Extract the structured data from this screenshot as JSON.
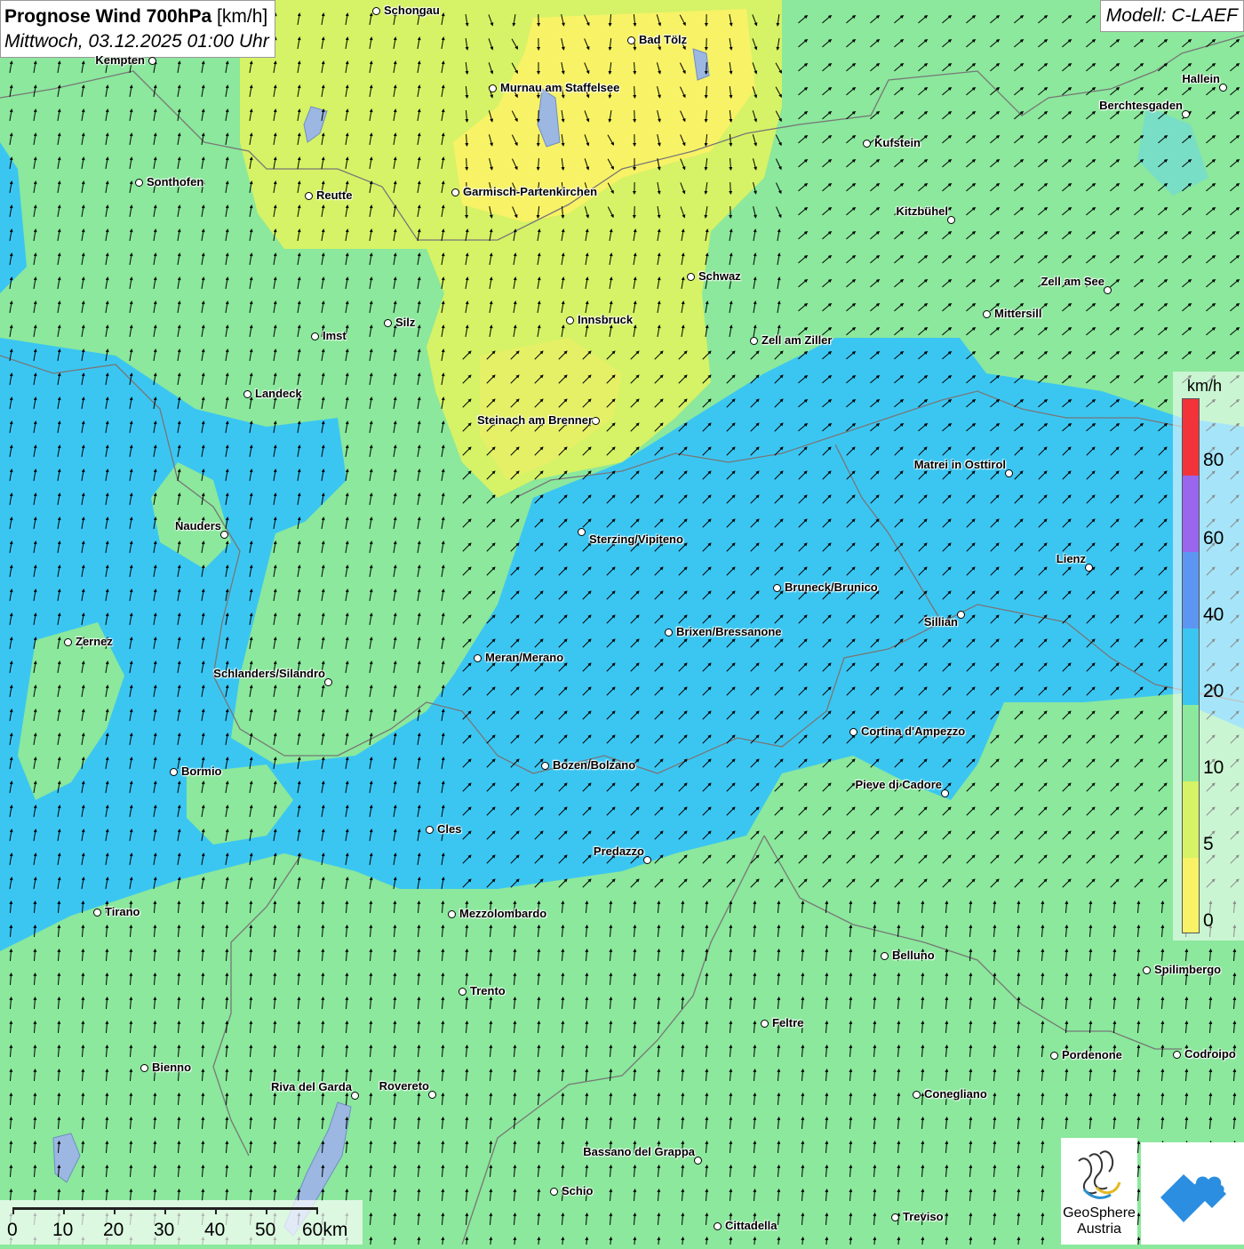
{
  "title": {
    "main": "Prognose Wind 700hPa",
    "unit": "[km/h]",
    "datetime": "Mittwoch, 03.12.2025 01:00 Uhr"
  },
  "model": "Modell: C-LAEF",
  "legend": {
    "unit": "km/h",
    "labels": [
      "80",
      "60",
      "40",
      "20",
      "10",
      "5",
      "0"
    ],
    "colors": [
      "#f2343a",
      "#9a66ee",
      "#5c96f2",
      "#3bc6f2",
      "#8be89c",
      "#d6f266",
      "#f8f266"
    ]
  },
  "scale": {
    "labels": [
      "0",
      "10",
      "20",
      "30",
      "40",
      "50",
      "60km"
    ]
  },
  "cities": [
    {
      "name": "Schongau"
    },
    {
      "name": "Bad Tölz"
    },
    {
      "name": "Kempten"
    },
    {
      "name": "Murnau am Staffelsee"
    },
    {
      "name": "Hallein"
    },
    {
      "name": "Berchtesgaden"
    },
    {
      "name": "Kufstein"
    },
    {
      "name": "Sonthofen"
    },
    {
      "name": "Reutte"
    },
    {
      "name": "Garmisch-Partenkirchen"
    },
    {
      "name": "Kitzbühel"
    },
    {
      "name": "Schwaz"
    },
    {
      "name": "Zell am See"
    },
    {
      "name": "Mittersill"
    },
    {
      "name": "Imst"
    },
    {
      "name": "Silz"
    },
    {
      "name": "Innsbruck"
    },
    {
      "name": "Zell am Ziller"
    },
    {
      "name": "Landeck"
    },
    {
      "name": "Steinach am Brenner"
    },
    {
      "name": "Matrei in Osttirol"
    },
    {
      "name": "Nauders"
    },
    {
      "name": "Sterzing/Vipiteno"
    },
    {
      "name": "Lienz"
    },
    {
      "name": "Bruneck/Brunico"
    },
    {
      "name": "Sillian"
    },
    {
      "name": "Zernez"
    },
    {
      "name": "Brixen/Bressanone"
    },
    {
      "name": "Meran/Merano"
    },
    {
      "name": "Schlanders/Silandro"
    },
    {
      "name": "Cortina d'Ampezzo"
    },
    {
      "name": "Bormio"
    },
    {
      "name": "Bozen/Bolzano"
    },
    {
      "name": "Pieve di Cadore"
    },
    {
      "name": "Cles"
    },
    {
      "name": "Predazzo"
    },
    {
      "name": "Tirano"
    },
    {
      "name": "Mezzolombardo"
    },
    {
      "name": "Belluno"
    },
    {
      "name": "Spilimbergo"
    },
    {
      "name": "Trento"
    },
    {
      "name": "Feltre"
    },
    {
      "name": "Pordenone"
    },
    {
      "name": "Codroipo"
    },
    {
      "name": "Bienno"
    },
    {
      "name": "Riva del Garda"
    },
    {
      "name": "Rovereto"
    },
    {
      "name": "Conegliano"
    },
    {
      "name": "Bassano del Grappa"
    },
    {
      "name": "Schio"
    },
    {
      "name": "Treviso"
    },
    {
      "name": "Cittadella"
    }
  ],
  "logos": {
    "geosphere_line1": "GeoSphere",
    "geosphere_line2": "Austria"
  }
}
